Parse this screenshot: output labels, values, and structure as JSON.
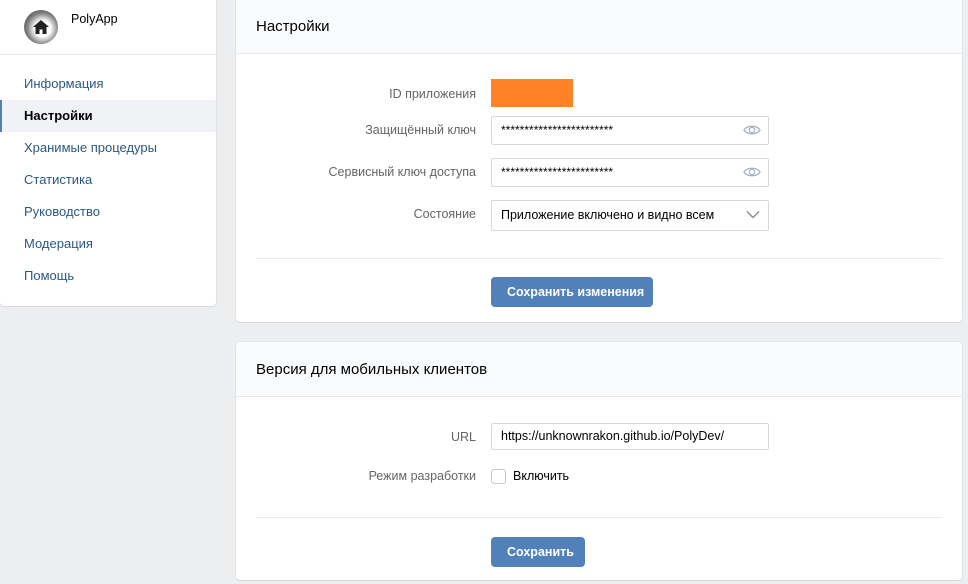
{
  "app": {
    "name": "PolyApp"
  },
  "sidebar": {
    "items": [
      {
        "label": "Информация",
        "active": false
      },
      {
        "label": "Настройки",
        "active": true
      },
      {
        "label": "Хранимые процедуры",
        "active": false
      },
      {
        "label": "Статистика",
        "active": false
      },
      {
        "label": "Руководство",
        "active": false
      },
      {
        "label": "Модерация",
        "active": false
      },
      {
        "label": "Помощь",
        "active": false
      }
    ]
  },
  "settings": {
    "title": "Настройки",
    "app_id_label": "ID приложения",
    "secret_key_label": "Защищённый ключ",
    "secret_key_value": "************************",
    "service_key_label": "Сервисный ключ доступа",
    "service_key_value": "************************",
    "state_label": "Состояние",
    "state_value": "Приложение включено и видно всем",
    "save_label": "Сохранить изменения",
    "redaction_color": "#ff8326"
  },
  "mobile": {
    "title": "Версия для мобильных клиентов",
    "url_label": "URL",
    "url_value": "https://unknownrakon.github.io/PolyDev/",
    "dev_mode_label": "Режим разработки",
    "dev_mode_checkbox_label": "Включить",
    "dev_mode_checked": false,
    "save_label": "Сохранить"
  },
  "colors": {
    "accent": "#5181b8",
    "link": "#2a5885",
    "background": "#edeef0"
  }
}
